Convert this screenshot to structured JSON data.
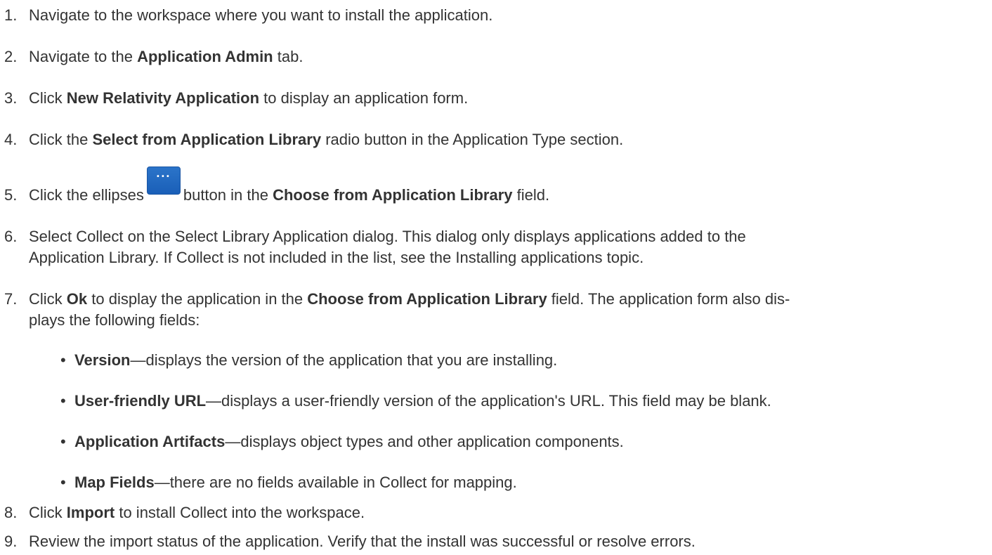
{
  "steps": [
    {
      "num": "1.",
      "pre": "Navigate to the workspace where you want to install the application."
    },
    {
      "num": "2.",
      "pre": "Navigate to the ",
      "bold": "Application Admin",
      "post": " tab."
    },
    {
      "num": "3.",
      "pre": "Click ",
      "bold": "New Relativity Application",
      "post": " to display an application form."
    },
    {
      "num": "4.",
      "pre": "Click the ",
      "bold": "Select from Application Library",
      "post": " radio button in the Application Type section."
    },
    {
      "num": "5.",
      "pre": "Click the ellipses",
      "button_glyph": "···",
      "mid": "button in the ",
      "bold": "Choose from Application Library",
      "post": " field."
    },
    {
      "num": "6.",
      "line1": "Select Collect on the Select Library Application dialog. This dialog only displays applications added to the",
      "line2": "Application Library. If Collect is not included in the list, see the Installing applications topic."
    },
    {
      "num": "7.",
      "pre": "Click ",
      "bold": "Ok",
      "mid": " to display the application in the ",
      "bold2": "Choose from Application Library",
      "post": " field. The application form also dis-",
      "line2": "plays the following fields:"
    },
    {
      "num": "8.",
      "pre": "Click ",
      "bold": "Import",
      "post": " to install Collect into the workspace."
    },
    {
      "num": "9.",
      "pre": "Review the import status of the application. Verify that the install was successful or resolve errors."
    }
  ],
  "bullets": [
    {
      "bold": "Version",
      "text": "—displays the version of the application that you are installing."
    },
    {
      "bold": "User-friendly URL",
      "text": "—displays a user-friendly version of the application's URL. This field may be blank."
    },
    {
      "bold": "Application Artifacts",
      "text": "—displays object types and other application components."
    },
    {
      "bold": "Map Fields",
      "text": "—there are no fields available in Collect for mapping."
    }
  ],
  "bullet_char": "•"
}
